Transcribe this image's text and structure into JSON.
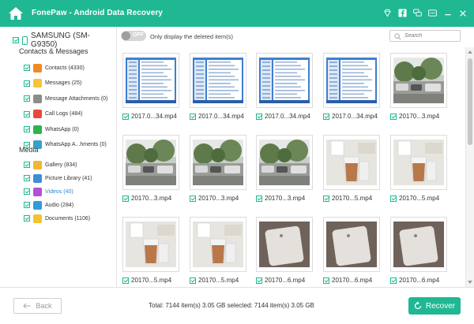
{
  "app": {
    "title": "FonePaw - Android Data Recovery",
    "accent": "#1fb893"
  },
  "titlebar_icons": [
    "diamond-icon",
    "facebook-icon",
    "chat-icon",
    "key-icon",
    "minimize-icon",
    "close-icon"
  ],
  "device": {
    "name": "SAMSUNG (SM-G9350)"
  },
  "sidebar": {
    "contacts_title": "Contacts & Messages",
    "contacts": [
      {
        "label": "Contacts (4330)",
        "icon": "contacts-icon",
        "color": "#f08a24"
      },
      {
        "label": "Messages (25)",
        "icon": "messages-icon",
        "color": "#f6c43a"
      },
      {
        "label": "Message Attachments (0)",
        "icon": "attachment-icon",
        "color": "#8c8c8c"
      },
      {
        "label": "Call Logs (484)",
        "icon": "call-logs-icon",
        "color": "#e8483b"
      },
      {
        "label": "WhatsApp (0)",
        "icon": "whatsapp-icon",
        "color": "#2fb34f"
      },
      {
        "label": "WhatsApp A...hments (0)",
        "icon": "whatsapp-attachment-icon",
        "color": "#3aa0c8"
      }
    ],
    "media_title": "Media",
    "media": [
      {
        "label": "Gallery (834)",
        "icon": "gallery-icon",
        "color": "#f2b632"
      },
      {
        "label": "Picture Library (41)",
        "icon": "picture-library-icon",
        "color": "#3d8ed8"
      },
      {
        "label": "Videos (40)",
        "icon": "videos-icon",
        "color": "#b44fd8",
        "active": true
      },
      {
        "label": "Audio (284)",
        "icon": "audio-icon",
        "color": "#2d9de0"
      },
      {
        "label": "Documents (1106)",
        "icon": "documents-icon",
        "color": "#f4c231"
      }
    ]
  },
  "toolbar": {
    "toggle_label": "OFF",
    "filter_label": "Only display the deleted item(s)",
    "search_placeholder": "Search"
  },
  "grid": {
    "items": [
      {
        "label": "2017.0...34.mp4",
        "kind": "screen"
      },
      {
        "label": "2017.0...34.mp4",
        "kind": "screen"
      },
      {
        "label": "2017.0...34.mp4",
        "kind": "screen"
      },
      {
        "label": "2017.0...34.mp4",
        "kind": "screen"
      },
      {
        "label": "20170...3.mp4",
        "kind": "street"
      },
      {
        "label": "20170...3.mp4",
        "kind": "street"
      },
      {
        "label": "20170...3.mp4",
        "kind": "street"
      },
      {
        "label": "20170...3.mp4",
        "kind": "street"
      },
      {
        "label": "20170...5.mp4",
        "kind": "cup"
      },
      {
        "label": "20170...5.mp4",
        "kind": "cup"
      },
      {
        "label": "20170...5.mp4",
        "kind": "cup"
      },
      {
        "label": "20170...5.mp4",
        "kind": "cup"
      },
      {
        "label": "20170...6.mp4",
        "kind": "phone"
      },
      {
        "label": "20170...6.mp4",
        "kind": "phone"
      },
      {
        "label": "20170...6.mp4",
        "kind": "phone"
      }
    ]
  },
  "footer": {
    "back_label": "Back",
    "totals": "Total: 7144 item(s) 3.05 GB   selected: 7144 item(s) 3.05 GB",
    "recover_label": "Recover"
  }
}
